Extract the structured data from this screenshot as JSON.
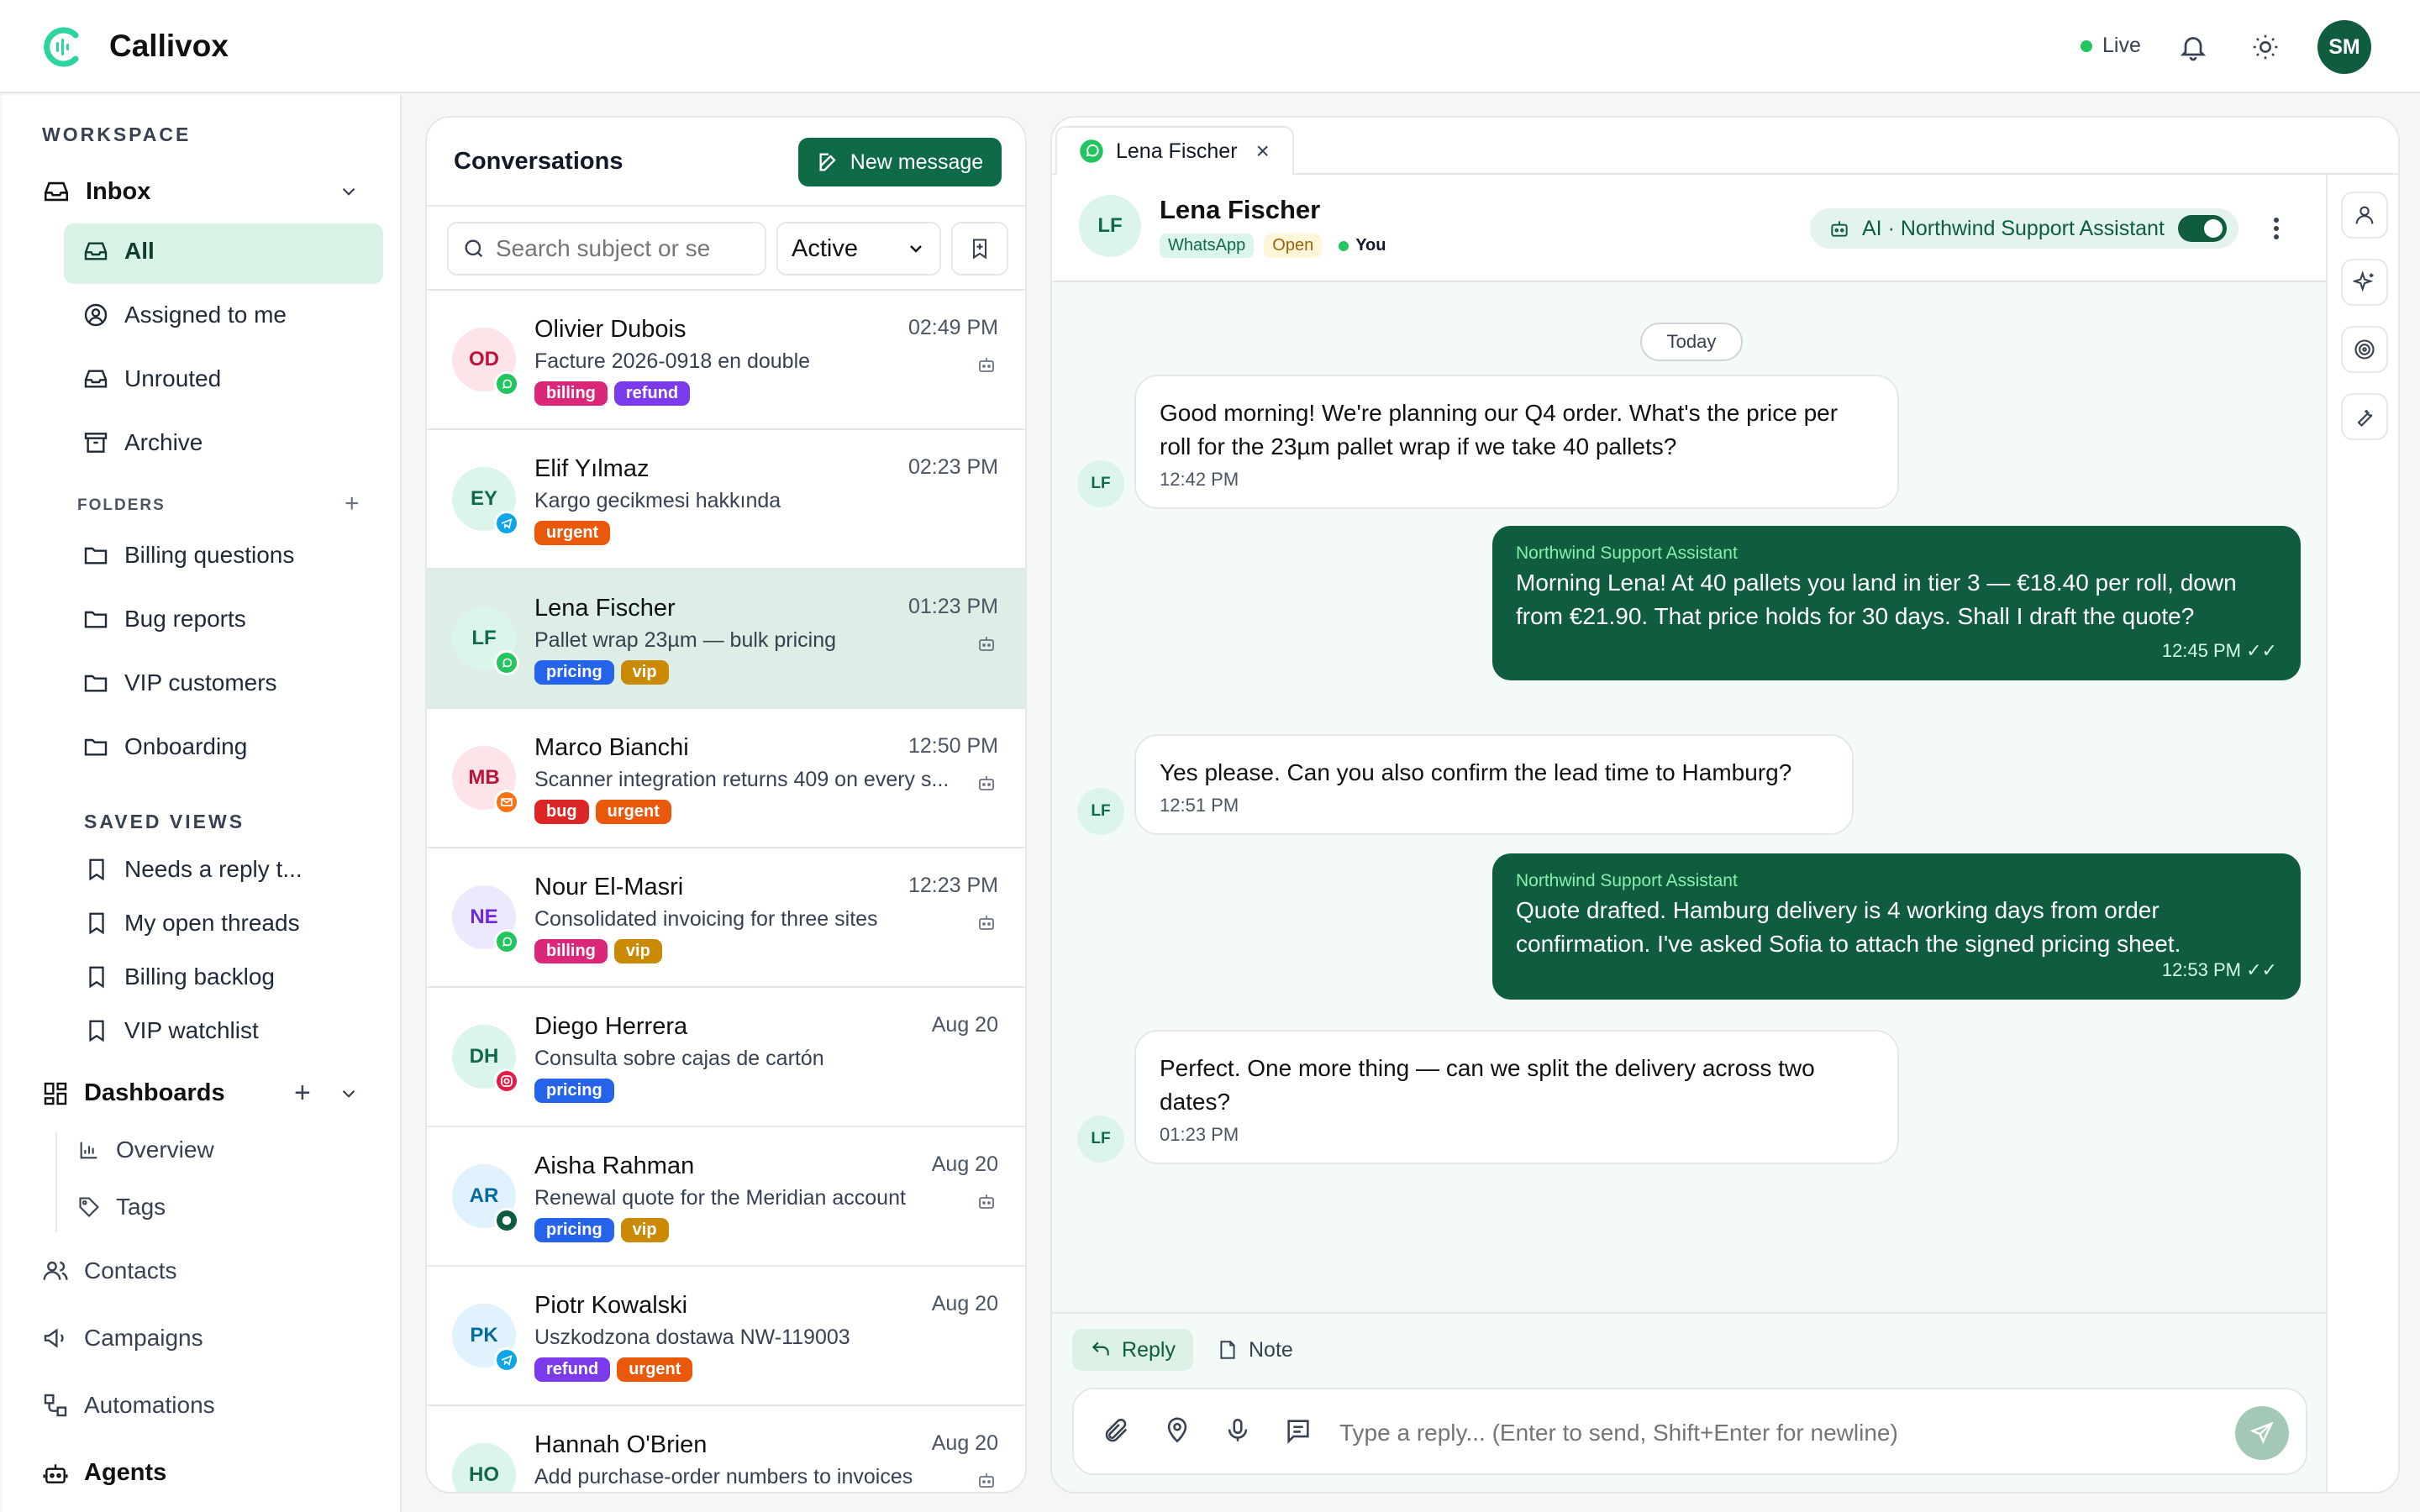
{
  "app": {
    "brand": "Callivox",
    "live_label": "Live",
    "user_initials": "SM"
  },
  "sidebar": {
    "workspace_label": "WORKSPACE",
    "inbox_label": "Inbox",
    "inbox_items": [
      {
        "label": "All"
      },
      {
        "label": "Assigned to me"
      },
      {
        "label": "Unrouted"
      },
      {
        "label": "Archive"
      }
    ],
    "folders_label": "FOLDERS",
    "folders": [
      "Billing questions",
      "Bug reports",
      "VIP customers",
      "Onboarding"
    ],
    "saved_views_label": "SAVED VIEWS",
    "saved_views": [
      "Needs a reply t...",
      "My open threads",
      "Billing backlog",
      "VIP watchlist"
    ],
    "dashboards_label": "Dashboards",
    "dashboards": [
      "Overview",
      "Tags"
    ],
    "nav": [
      "Contacts",
      "Campaigns",
      "Automations",
      "Agents"
    ]
  },
  "conversations": {
    "title": "Conversations",
    "new_message_label": "New message",
    "search_placeholder": "Search subject or se",
    "filter_value": "Active",
    "items": [
      {
        "initials": "OD",
        "name": "Olivier Dubois",
        "time": "02:49 PM",
        "subject": "Facture 2026-0918 en double",
        "tags": [
          "billing",
          "refund"
        ],
        "channel": "whatsapp",
        "bot": true,
        "avatar_bg": "#fde4e8",
        "avatar_fg": "#be123c"
      },
      {
        "initials": "EY",
        "name": "Elif Yılmaz",
        "time": "02:23 PM",
        "subject": "Kargo gecikmesi hakkında",
        "tags": [
          "urgent"
        ],
        "channel": "telegram",
        "bot": false,
        "avatar_bg": "#dcf5ea",
        "avatar_fg": "#0f6b47"
      },
      {
        "initials": "LF",
        "name": "Lena Fischer",
        "time": "01:23 PM",
        "subject": "Pallet wrap 23µm — bulk pricing",
        "tags": [
          "pricing",
          "vip"
        ],
        "channel": "whatsapp",
        "bot": true,
        "avatar_bg": "#dcf5ea",
        "avatar_fg": "#0f6b47"
      },
      {
        "initials": "MB",
        "name": "Marco Bianchi",
        "time": "12:50 PM",
        "subject": "Scanner integration returns 409 on every s...",
        "tags": [
          "bug",
          "urgent"
        ],
        "channel": "email",
        "bot": true,
        "avatar_bg": "#fde4e8",
        "avatar_fg": "#be123c"
      },
      {
        "initials": "NE",
        "name": "Nour El-Masri",
        "time": "12:23 PM",
        "subject": "Consolidated invoicing for three sites",
        "tags": [
          "billing",
          "vip"
        ],
        "channel": "whatsapp",
        "bot": true,
        "avatar_bg": "#ece8fd",
        "avatar_fg": "#6d28d9"
      },
      {
        "initials": "DH",
        "name": "Diego Herrera",
        "time": "Aug 20",
        "subject": "Consulta sobre cajas de cartón",
        "tags": [
          "pricing"
        ],
        "channel": "instagram",
        "bot": false,
        "avatar_bg": "#dcf5ea",
        "avatar_fg": "#0f6b47"
      },
      {
        "initials": "AR",
        "name": "Aisha Rahman",
        "time": "Aug 20",
        "subject": "Renewal quote for the Meridian account",
        "tags": [
          "pricing",
          "vip"
        ],
        "channel": "chat",
        "bot": true,
        "avatar_bg": "#e0f2fe",
        "avatar_fg": "#0369a1"
      },
      {
        "initials": "PK",
        "name": "Piotr Kowalski",
        "time": "Aug 20",
        "subject": "Uszkodzona dostawa NW-119003",
        "tags": [
          "refund",
          "urgent"
        ],
        "channel": "telegram",
        "bot": false,
        "avatar_bg": "#e0f2fe",
        "avatar_fg": "#0369a1"
      },
      {
        "initials": "HO",
        "name": "Hannah O'Brien",
        "time": "Aug 20",
        "subject": "Add purchase-order numbers to invoices",
        "tags": [],
        "channel": "none",
        "bot": true,
        "avatar_bg": "#dcf5ea",
        "avatar_fg": "#0f6b47"
      }
    ]
  },
  "tag_colors": {
    "billing": "#db2777",
    "refund": "#7c3aed",
    "urgent": "#ea580c",
    "pricing": "#2563eb",
    "vip": "#ca8a04",
    "bug": "#dc2626"
  },
  "chat": {
    "tab_label": "Lena Fischer",
    "contact_initials": "LF",
    "contact_name": "Lena Fischer",
    "pills": {
      "channel": "WhatsApp",
      "status": "Open",
      "assignee": "You"
    },
    "ai_label": "AI · Northwind Support Assistant",
    "date_label": "Today",
    "messages": [
      {
        "dir": "in",
        "text": "Good morning! We're planning our Q4 order. What's the price per roll for the 23µm pallet wrap if we take 40 pallets?",
        "time": "12:42 PM"
      },
      {
        "dir": "out",
        "from": "Northwind Support Assistant",
        "text": "Morning Lena! At 40 pallets you land in tier 3 — €18.40 per roll, down from €21.90. That price holds for 30 days. Shall I draft the quote?",
        "time": "12:45 PM"
      },
      {
        "dir": "in",
        "text": "Yes please. Can you also confirm the lead time to Hamburg?",
        "time": "12:51 PM"
      },
      {
        "dir": "out",
        "from": "Northwind Support Assistant",
        "text": "Quote drafted. Hamburg delivery is 4 working days from order confirmation. I've asked Sofia to attach the signed pricing sheet.",
        "time": "12:53 PM"
      },
      {
        "dir": "in",
        "text": "Perfect. One more thing — can we split the delivery across two dates?",
        "time": "01:23 PM"
      }
    ],
    "reply_label": "Reply",
    "note_label": "Note",
    "input_placeholder": "Type a reply... (Enter to send, Shift+Enter for newline)"
  }
}
